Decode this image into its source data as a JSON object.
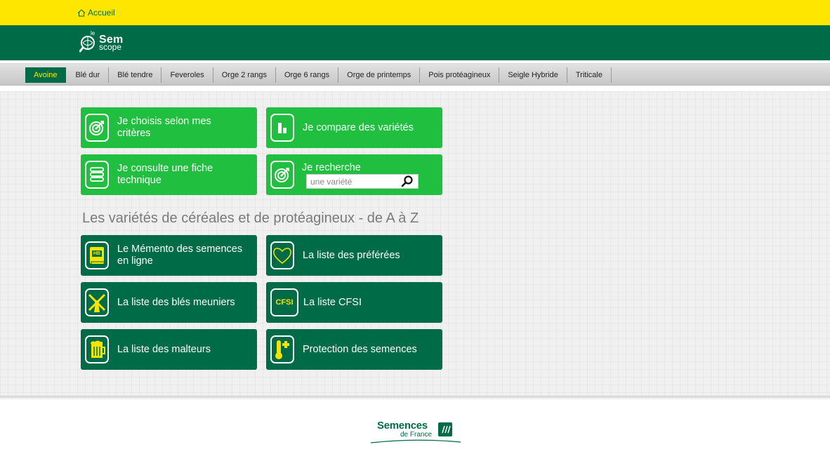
{
  "topbar": {
    "home_label": "Accueil"
  },
  "header": {
    "logo_le": "le",
    "logo_sem": "Sem",
    "logo_scope": "scope"
  },
  "nav": {
    "items": [
      {
        "label": "Avoine",
        "active": true
      },
      {
        "label": "Blé dur"
      },
      {
        "label": "Blé tendre"
      },
      {
        "label": "Feveroles"
      },
      {
        "label": "Orge 2 rangs"
      },
      {
        "label": "Orge 6 rangs"
      },
      {
        "label": "Orge de printemps"
      },
      {
        "label": "Pois protéagineux"
      },
      {
        "label": "Seigle Hybride"
      },
      {
        "label": "Triticale"
      }
    ]
  },
  "tools": {
    "criteria": "Je choisis selon mes critères",
    "compare": "Je compare des variétés",
    "fiche": "Je consulte une fiche technique",
    "search_label": "Je recherche",
    "search_placeholder": "une variété"
  },
  "section": {
    "title": "Les variétés de céréales et de protéagineux - de A à Z"
  },
  "lists": {
    "memento": "Le Mémento des semences en ligne",
    "memento_badge": "HB",
    "preferees": "La liste des préférées",
    "meuniers": "La liste des blés meuniers",
    "cfsi": "La liste CFSI",
    "cfsi_badge": "CFSI",
    "malteurs": "La liste des malteurs",
    "protection": "Protection des semences"
  },
  "footer": {
    "brand": "Semences",
    "brand_sub": "de France"
  },
  "colors": {
    "yellow": "#ffe600",
    "dark_green": "#006b47",
    "bright_green": "#20bf40",
    "badge_yellow": "#f5e400"
  }
}
